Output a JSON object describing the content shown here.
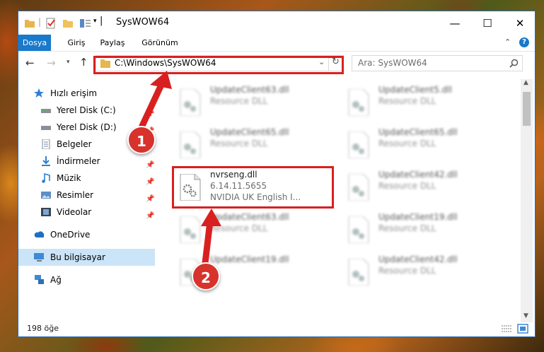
{
  "window": {
    "title": "SysWOW64",
    "minimize_label": "—",
    "maximize_label": "☐",
    "close_label": "✕",
    "help_label": "?",
    "collapse_ribbon_label": "⌃"
  },
  "ribbon": {
    "tabs": [
      {
        "label": "Dosya"
      },
      {
        "label": "Giriş"
      },
      {
        "label": "Paylaş"
      },
      {
        "label": "Görünüm"
      }
    ]
  },
  "address": {
    "path": "C:\\Windows\\SysWOW64",
    "search_placeholder": "Ara: SysWOW64"
  },
  "navigation": {
    "items": [
      {
        "label": "Hızlı erişim",
        "icon": "star-icon"
      },
      {
        "label": "Yerel Disk (C:)",
        "icon": "drive-icon",
        "pinned": true
      },
      {
        "label": "Yerel Disk (D:)",
        "icon": "drive-icon",
        "pinned": true
      },
      {
        "label": "Belgeler",
        "icon": "documents-icon",
        "pinned": true
      },
      {
        "label": "İndirmeler",
        "icon": "downloads-icon",
        "pinned": true
      },
      {
        "label": "Müzik",
        "icon": "music-icon",
        "pinned": true
      },
      {
        "label": "Resimler",
        "icon": "pictures-icon",
        "pinned": true
      },
      {
        "label": "Videolar",
        "icon": "videos-icon",
        "pinned": true
      },
      {
        "label": "OneDrive",
        "icon": "cloud-icon"
      },
      {
        "label": "Bu bilgisayar",
        "icon": "computer-icon",
        "selected": true
      },
      {
        "label": "Ağ",
        "icon": "network-icon"
      }
    ]
  },
  "files": {
    "left_column": [
      {
        "name": "UpdateClient63.dll",
        "desc": "Resource DLL"
      },
      {
        "name": "UpdateClient65.dll",
        "desc": "Resource DLL"
      },
      {
        "name": "nvrseng.dll",
        "version": "6.14.11.5655",
        "company": "NVIDIA UK English I..."
      },
      {
        "name": "UpdateClient63.dll",
        "desc": "Resource DLL"
      },
      {
        "name": "UpdateClient19.dll",
        "desc": ""
      }
    ],
    "right_column": [
      {
        "name": "UpdateClient5.dll",
        "desc": "Resource DLL"
      },
      {
        "name": "UpdateClient65.dll",
        "desc": "Resource DLL"
      },
      {
        "name": "UpdateClient42.dll",
        "desc": "Resource DLL"
      },
      {
        "name": "UpdateClient19.dll",
        "desc": "Resource DLL"
      },
      {
        "name": "UpdateClient42.dll",
        "desc": "Resource DLL"
      }
    ]
  },
  "status": {
    "item_count": "198 öğe"
  },
  "annotations": {
    "step1": "1",
    "step2": "2",
    "color": "#d92020"
  }
}
